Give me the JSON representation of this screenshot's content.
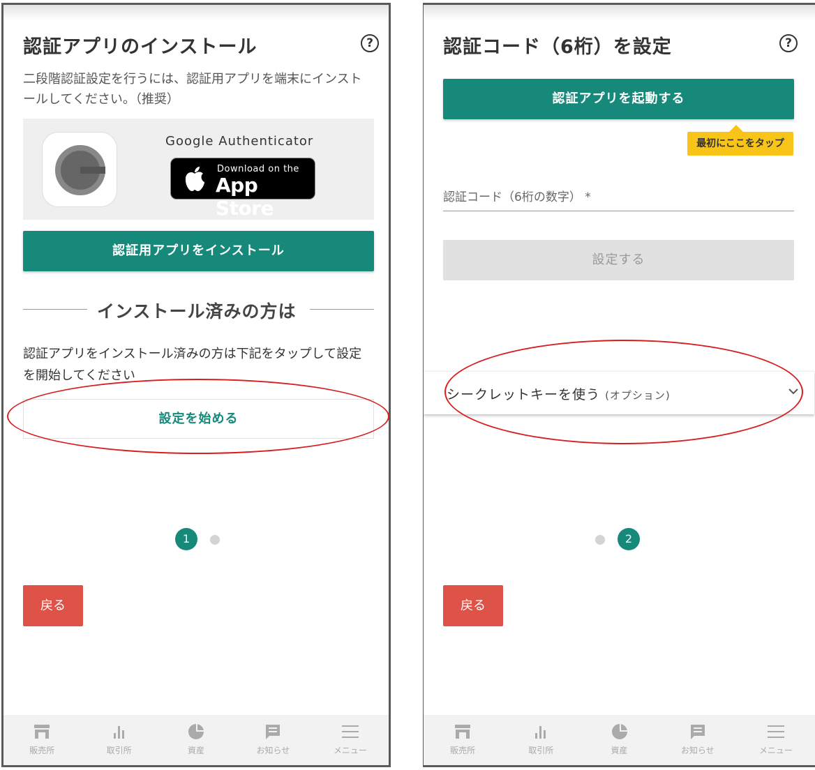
{
  "left_screen": {
    "title": "認証アプリのインストール",
    "help_icon": "?",
    "description": "二段階認証設定を行うには、認証用アプリを端末にインストールしてください。（推奨）",
    "app_card": {
      "app_name": "Google Authenticator",
      "badge_small": "Download on the",
      "badge_big": "App Store"
    },
    "install_button": "認証用アプリをインストール",
    "divider_text": "インストール済みの方は",
    "body_text": "認証アプリをインストール済みの方は下記をタップして設定を開始してください",
    "start_button": "設定を始める",
    "step_active": "1",
    "back_button": "戻る"
  },
  "right_screen": {
    "title": "認証コード（6桁）を設定",
    "help_icon": "?",
    "launch_button": "認証アプリを起動する",
    "tooltip": "最初にここをタップ",
    "code_input_label": "認証コード（6桁の数字） *",
    "set_button": "設定する",
    "secret_key_label": "シークレットキーを使う",
    "secret_key_option": "(オプション)",
    "step_active": "2",
    "back_button": "戻る"
  },
  "bottom_nav": [
    {
      "label": "販売所",
      "icon": "store-icon"
    },
    {
      "label": "取引所",
      "icon": "bar-chart-icon"
    },
    {
      "label": "資産",
      "icon": "pie-chart-icon"
    },
    {
      "label": "お知らせ",
      "icon": "message-icon"
    },
    {
      "label": "メニュー",
      "icon": "menu-icon"
    }
  ],
  "colors": {
    "accent_green": "#17897a",
    "back_red": "#de5248",
    "tooltip_yellow": "#f7c417",
    "annotation_red": "#d81e1e"
  }
}
